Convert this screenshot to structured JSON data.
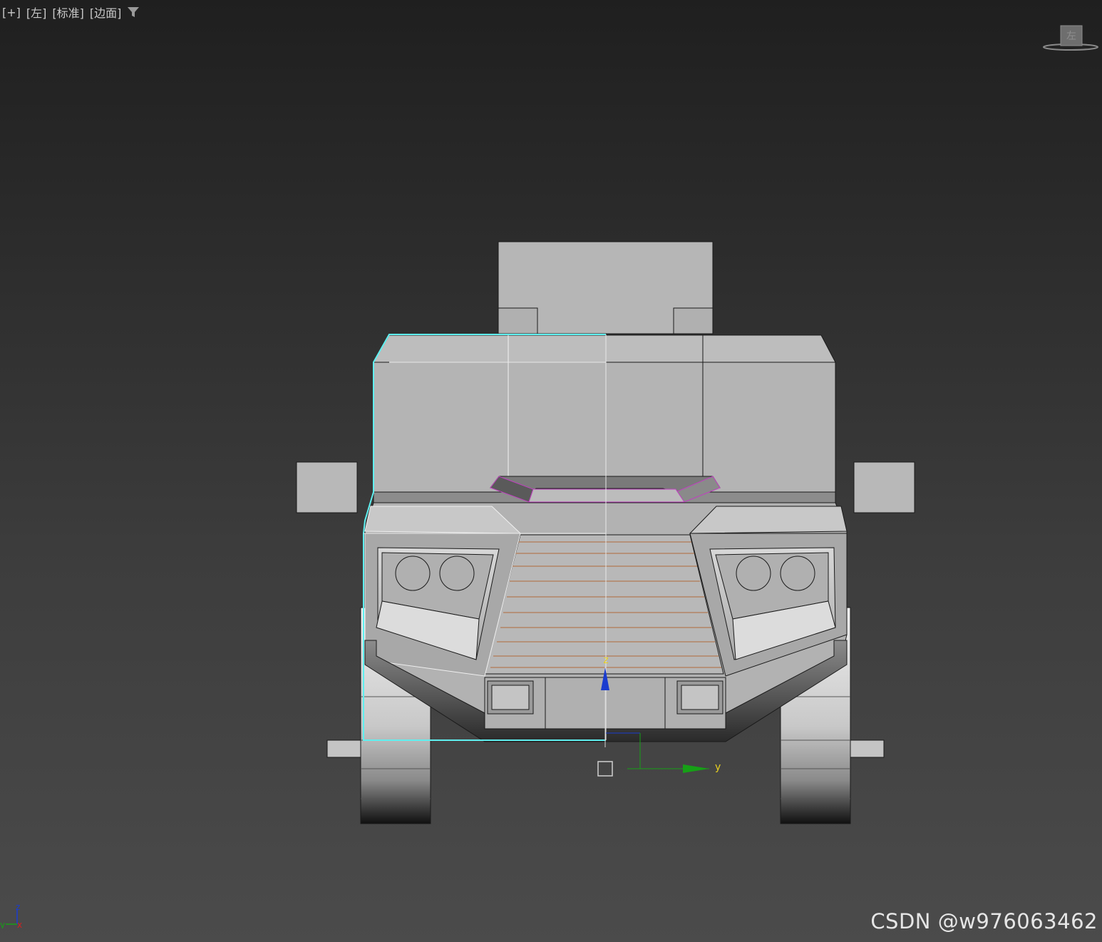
{
  "viewport": {
    "menu_plus": "[+]",
    "view_name": "[左]",
    "shading_mode": "[标准]",
    "display_mode": "[边面]",
    "filter_icon": "filter-icon"
  },
  "viewcube": {
    "face_label": "左"
  },
  "gizmo": {
    "axis_z": "z",
    "axis_y": "y"
  },
  "axis_tripod": {
    "z": "z",
    "y": "y",
    "x": "x"
  },
  "watermark": {
    "text": "CSDN @w976063462"
  },
  "colors": {
    "selection": "#5ff0f0",
    "model_light": "#b4b4b4",
    "model_mid": "#9a9a9a",
    "grille_lines": "#b06a3a",
    "edge_highlight": "#c040c0",
    "axis_z": "#1a3ccf",
    "axis_y": "#16a016",
    "axis_x": "#d02020"
  }
}
